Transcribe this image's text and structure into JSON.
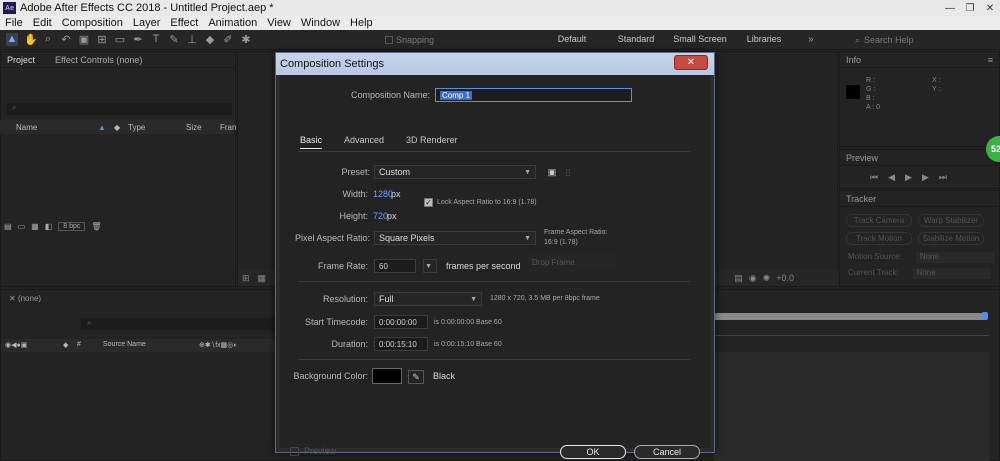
{
  "titlebar": {
    "logo": "Ae",
    "title": "Adobe After Effects CC 2018 - Untitled Project.aep *"
  },
  "menu": [
    "File",
    "Edit",
    "Composition",
    "Layer",
    "Effect",
    "Animation",
    "View",
    "Window",
    "Help"
  ],
  "toolbar": {
    "snapping": "Snapping",
    "workspaces": [
      "Default",
      "Standard",
      "Small Screen",
      "Libraries"
    ],
    "search_placeholder": "Search Help"
  },
  "project_panel": {
    "tab_project": "Project",
    "tab_effects": "Effect Controls (none)",
    "columns": [
      "Name",
      "Type",
      "Size",
      "Fran"
    ],
    "bpc": "8 bpc"
  },
  "info_panel": {
    "title": "Info",
    "r": "R :",
    "g": "G :",
    "b": "B :",
    "a": "A : 0",
    "x": "X :",
    "y": "Y :"
  },
  "preview_panel": {
    "title": "Preview"
  },
  "tracker_panel": {
    "title": "Tracker",
    "buttons": [
      "Track Camera",
      "Warp Stabilizer",
      "Track Motion",
      "Stabilize Motion"
    ],
    "motion_source_label": "Motion Source:",
    "motion_source_value": "None",
    "current_track_label": "Current Track:",
    "current_track_value": "None"
  },
  "comp_panel": {
    "zoom": "+0.0"
  },
  "timeline": {
    "tab": "(none)",
    "source_name": "Source Name"
  },
  "badge": "52",
  "dialog": {
    "title": "Composition Settings",
    "close": "✕",
    "comp_name_label": "Composition Name:",
    "comp_name_value": "Comp 1",
    "tabs": [
      "Basic",
      "Advanced",
      "3D Renderer"
    ],
    "preset_label": "Preset:",
    "preset_value": "Custom",
    "width_label": "Width:",
    "width_value": "1280",
    "height_label": "Height:",
    "height_value": "720",
    "px": "px",
    "lock_aspect": "Lock Aspect Ratio to 16:9 (1.78)",
    "par_label": "Pixel Aspect Ratio:",
    "par_value": "Square Pixels",
    "frame_aspect_label": "Frame Aspect Ratio:",
    "frame_aspect_value": "16:9 (1.78)",
    "frame_rate_label": "Frame Rate:",
    "frame_rate_value": "60",
    "frames_per_second": "frames per second",
    "drop_frame": "Drop Frame",
    "resolution_label": "Resolution:",
    "resolution_value": "Full",
    "resolution_info": "1280 x 720, 3.5 MB per 8bpc frame",
    "start_tc_label": "Start Timecode:",
    "start_tc_value": "0:00:00:00",
    "start_tc_info": "is 0:00:00:00  Base 60",
    "duration_label": "Duration:",
    "duration_value": "0:00:15:10",
    "duration_info": "is 0:00:15:10  Base 60",
    "bg_label": "Background Color:",
    "bg_value": "Black",
    "bg_color": "#000000",
    "preview": "Preview",
    "ok": "OK",
    "cancel": "Cancel"
  }
}
